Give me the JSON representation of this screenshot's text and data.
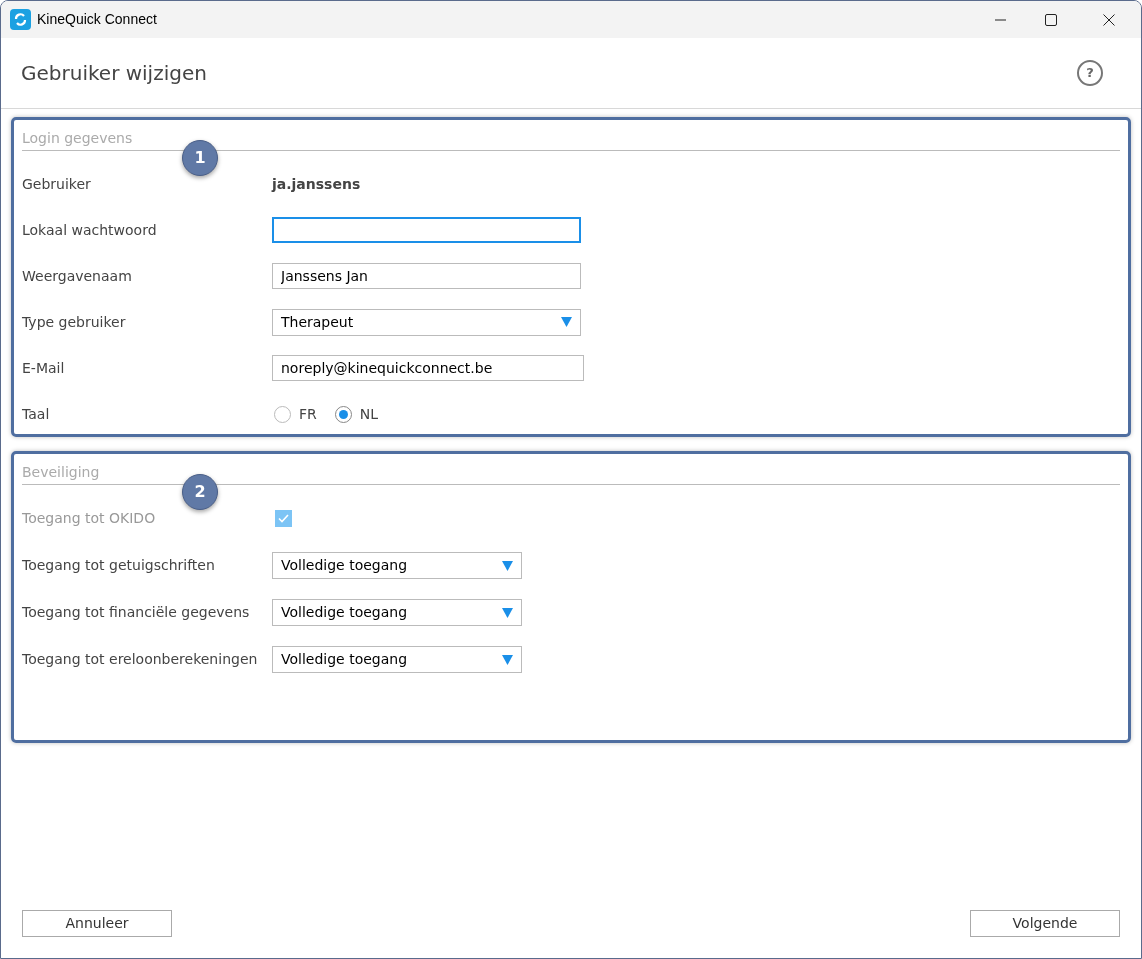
{
  "window": {
    "title": "KineQuick Connect"
  },
  "header": {
    "title": "Gebruiker wijzigen",
    "help": "?"
  },
  "sections": [
    {
      "legend": "Login gegevens",
      "badge": "1",
      "rows": [
        {
          "kind": "static",
          "label": "Gebruiker",
          "value": "ja.janssens"
        },
        {
          "kind": "password",
          "label": "Lokaal wachtwoord",
          "focused": true
        },
        {
          "kind": "text",
          "label": "Weergavenaam",
          "value": "Janssens Jan",
          "focused": false
        },
        {
          "kind": "select",
          "label": "Type gebruiker",
          "value": "Therapeut"
        },
        {
          "kind": "text",
          "label": "E-Mail",
          "value": "noreply@kinequickconnect.be",
          "focused": false
        },
        {
          "kind": "radio",
          "label": "Taal",
          "options": [
            {
              "label": "FR",
              "selected": false
            },
            {
              "label": "NL",
              "selected": true
            }
          ]
        }
      ]
    },
    {
      "legend": "Beveiliging",
      "badge": "2",
      "rows": [
        {
          "kind": "checkbox",
          "label": "Toegang tot OKIDO",
          "checked": true,
          "disabled": true
        },
        {
          "kind": "select",
          "label": "Toegang tot getuigschriften",
          "value": "Volledige toegang"
        },
        {
          "kind": "select",
          "label": "Toegang tot financiële gegevens",
          "value": "Volledige toegang"
        },
        {
          "kind": "select",
          "label": "Toegang tot ereloonberekeningen",
          "value": "Volledige toegang"
        }
      ]
    }
  ],
  "buttons": {
    "cancel": "Annuleer",
    "next": "Volgende"
  }
}
